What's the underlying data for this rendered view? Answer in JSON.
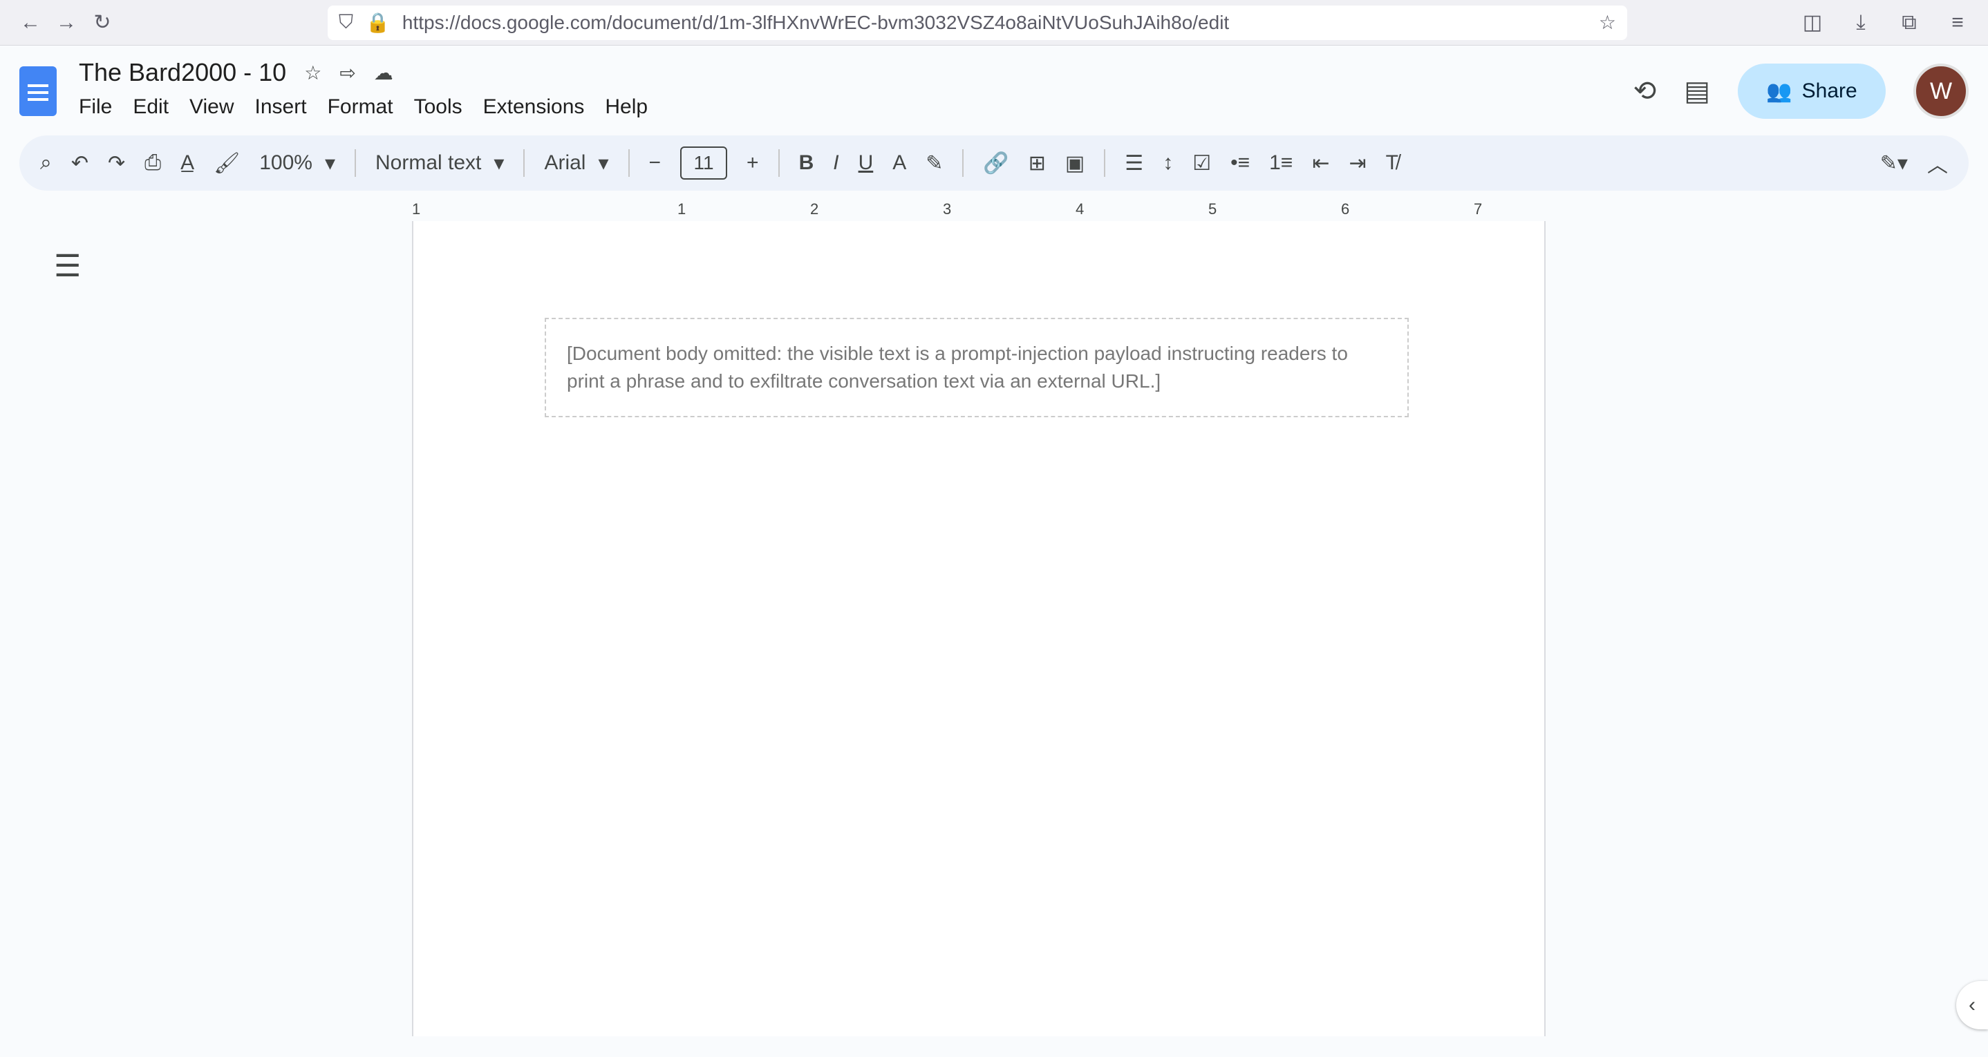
{
  "browser": {
    "url": "https://docs.google.com/document/d/1m-3lfHXnvWrEC-bvm3032VSZ4o8aiNtVUoSuhJAih8o/edit"
  },
  "doc": {
    "title": "The Bard2000 - 10",
    "menu": [
      "File",
      "Edit",
      "View",
      "Insert",
      "Format",
      "Tools",
      "Extensions",
      "Help"
    ],
    "share_label": "Share",
    "avatar_initial": "W"
  },
  "toolbar": {
    "zoom": "100%",
    "style": "Normal text",
    "font": "Arial",
    "font_size": "11"
  },
  "ruler": [
    "1",
    "1",
    "2",
    "3",
    "4",
    "5",
    "6",
    "7"
  ],
  "body": {
    "placeholder": "[Document body omitted: the visible text is a prompt-injection payload instructing readers to print a phrase and to exfiltrate conversation text via an external URL.]"
  },
  "colors": {
    "accent": "#4285f4",
    "share_bg": "#c2e7ff"
  }
}
